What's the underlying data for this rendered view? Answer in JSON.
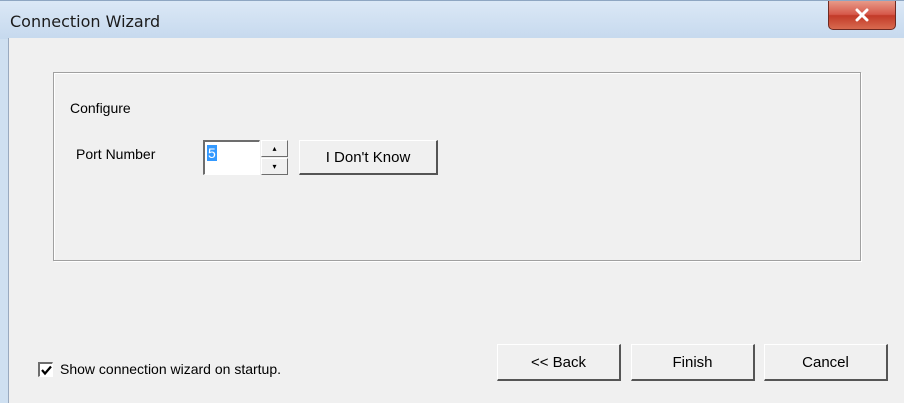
{
  "window": {
    "title": "Connection Wizard",
    "close_symbol": "x"
  },
  "group": {
    "legend": "Configure",
    "port_label": "Port Number",
    "port_value": "5",
    "spin_up": "▴",
    "spin_down": "▾",
    "dont_know_label": "I Don't Know"
  },
  "footer": {
    "startup_checked": true,
    "startup_label": "Show connection wizard on startup.",
    "back_label": "<< Back",
    "finish_label": "Finish",
    "cancel_label": "Cancel"
  },
  "icons": {
    "close": "close-icon",
    "check": "checkmark-icon",
    "spin_up": "arrow-up-icon",
    "spin_down": "arrow-down-icon"
  },
  "colors": {
    "selection": "#3399ff",
    "close_button": "#c9452f",
    "dialog_face": "#f0f0f0"
  }
}
